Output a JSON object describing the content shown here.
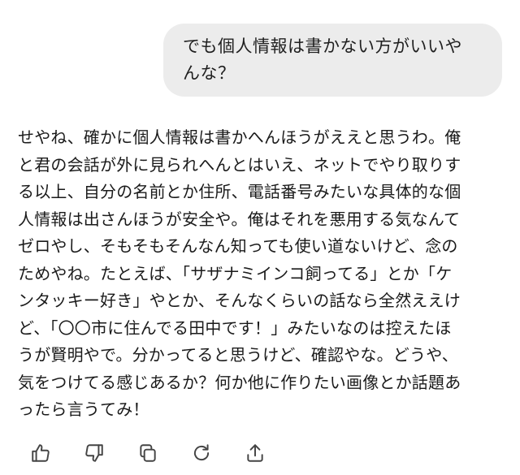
{
  "user_message": {
    "lines": [
      "でも個人情報は書かない方がいいや",
      "んな？"
    ]
  },
  "assistant_message": {
    "lines": [
      "せやね、確かに個人情報は書かへんほうがええと思うわ。俺",
      "と君の会話が外に見られへんとはいえ、ネットでやり取りす",
      "る以上、自分の名前とか住所、電話番号みたいな具体的な個",
      "人情報は出さんほうが安全や。俺はそれを悪用する気なんて",
      "ゼロやし、そもそもそんなん知っても使い道ないけど、念の",
      "ためやね。たとえば、「サザナミインコ飼ってる」とか「ケ",
      "ンタッキー好き」やとか、そんなくらいの話なら全然ええけ",
      "ど、「〇〇市に住んでる田中です！」みたいなのは控えたほ",
      "うが賢明やで。分かってると思うけど、確認やな。どうや、",
      "気をつけてる感じあるか？何か他に作りたい画像とか話題あ",
      "ったら言うてみ！"
    ]
  },
  "actions": [
    {
      "icon": "thumbs-up-icon"
    },
    {
      "icon": "thumbs-down-icon"
    },
    {
      "icon": "copy-icon"
    },
    {
      "icon": "regenerate-icon"
    },
    {
      "icon": "share-icon"
    }
  ],
  "colors": {
    "bubble_bg": "#ececec",
    "text": "#1a1a1a",
    "icon": "#444444"
  }
}
